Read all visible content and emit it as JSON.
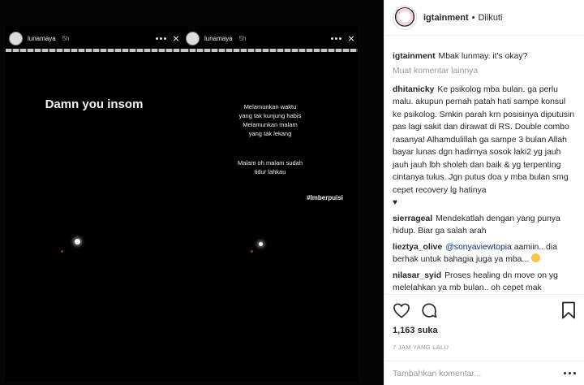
{
  "story": {
    "username": "lunamaya",
    "time": "5h",
    "left_text": "Damn you insom",
    "poem_lines_1": [
      "Melamunkan waktu",
      "yang tak kunjung habis",
      "Melamunkan malam",
      "yang tak lekang"
    ],
    "poem_lines_2": [
      "Malam oh malam sudah",
      "tidur lahkau"
    ],
    "hashtag": "#Imberpuisi"
  },
  "header": {
    "username": "igtainment",
    "separator": "•",
    "follow_status": "Diikuti"
  },
  "caption": {
    "username": "igtainment",
    "text": "Mbak lunmay. it's okay?"
  },
  "load_more_label": "Muat komentar lainnya",
  "comments": [
    {
      "username": "dhitanicky",
      "text": "Ke psikolog mba bulan. ga perlu malu. akupun pernah patah hati sampe konsul ke psikolog. Smkin parah krn posisinya diputusin pas lagi sakit dan dirawat di RS. Double combo rasanya! Alhamdulillah ga sampe 3 bulan Allah bayar lunas dgn hadirnya sosok laki2 yg jauh jauh jauh lbh sholeh dan baik & yg terpenting cintanya tulus. Jgn putus doa y mba bulan smg cepet recovery lg hatinya",
      "suffix": "♥"
    },
    {
      "username": "sierrageal",
      "text": "Mendekatlah dengan yang punya hidup. Biar ga salah arah"
    },
    {
      "username": "lieztya_olive",
      "mention": "@sonyaviewtopia",
      "text": "aamiin.. dia berhak untuk bahagia juga ya mba..."
    },
    {
      "username": "nilasar_syid",
      "text": "Proses healing dn move on yg melelahkan ya mb bulan.. oh cepet mak"
    }
  ],
  "likes": "1,163 suka",
  "time_ago": "7 JAM YANG LALU",
  "add_comment_placeholder": "Tambahkan komentar...",
  "icons": {
    "like": "heart-icon",
    "comment": "comment-icon",
    "save": "bookmark-icon",
    "more": "more-options-icon"
  }
}
